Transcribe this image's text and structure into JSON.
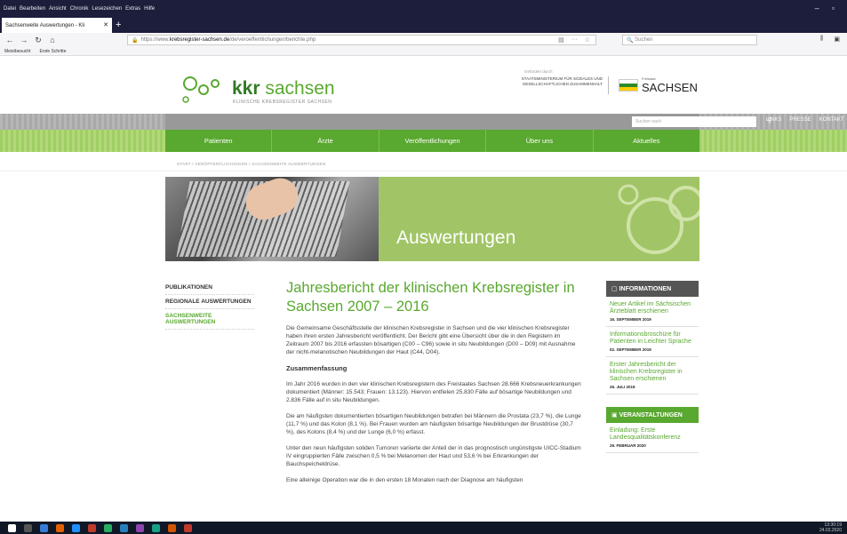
{
  "browser": {
    "menu": [
      "Datei",
      "Bearbeiten",
      "Ansicht",
      "Chronik",
      "Lesezeichen",
      "Extras",
      "Hilfe"
    ],
    "tab_title": "Sachsenweite Auswertungen - Kli",
    "url_prefix": "https://www.",
    "url_host": "krebsregister-sachsen.de",
    "url_path": "/de/veroeffentlichungen/berichte.php",
    "search_placeholder": "Suchen",
    "bookmarks": [
      "Meistbesucht",
      "Erste Schritte"
    ]
  },
  "header": {
    "logo_bold": "kkr",
    "logo_rest": " sachsen",
    "logo_sub": "KLINISCHE KREBSREGISTER SACHSEN",
    "gefoerdert": "Gefördert durch",
    "ministry": "STAATSMINISTERIUM FÜR SOZIALES UND GESELLSCHAFTLICHEN ZUSAMMENHALT",
    "freistaat": "Freistaat",
    "sachsen": "SACHSEN",
    "site_search_placeholder": "Suchen nach",
    "top_links": [
      "LINKS",
      "PRESSE",
      "KONTAKT"
    ]
  },
  "main_nav": [
    "Patienten",
    "Ärzte",
    "Veröffentlichungen",
    "Über uns",
    "Aktuelles"
  ],
  "breadcrumb": "START / VERÖFFENTLICHUNGEN / SACHSENWEITE AUSWERTUNGEN",
  "hero_title": "Auswertungen",
  "left_nav": [
    "PUBLIKATIONEN",
    "REGIONALE AUSWERTUNGEN",
    "SACHSENWEITE AUSWERTUNGEN"
  ],
  "article": {
    "title": "Jahresbericht der klinischen Krebsregister in Sachsen 2007 – 2016",
    "p1": "Die Gemeinsame Geschäftsstelle der klinischen Krebsregister in Sachsen und die vier klinischen Krebsregister haben ihren ersten Jahresbericht veröffentlicht. Der Bericht gibt eine Übersicht über die in den Registern im Zeitraum 2007 bis 2016 erfassten bösartigen (C00 – C96) sowie in situ Neubildungen (D00 – D09) mit Ausnahme der nicht-melanotischen Neubildungen der Haut (C44, D04).",
    "summary_heading": "Zusammenfassung",
    "p2": "Im Jahr 2016 wurden in den vier klinischen Krebsregistern des Freistaates Sachsen 28.666 Krebsneuerkrankungen dokumentiert (Männer: 15.543; Frauen: 13.123). Hiervon entfielen 25.830 Fälle auf bösartige Neubildungen und 2.836 Fälle auf in situ Neubildungen.",
    "p3": "Die am häufigsten dokumentierten bösartigen Neubildungen betrafen bei Männern die Prostata (23,7 %), die Lunge (11,7 %) und das Kolon (8,1 %). Bei Frauen wurden am häufigsten bösartige Neubildungen der Brustdrüse (30,7 %), des Kolons (8,4 %) und der Lunge (6,0 %) erfasst.",
    "p4": "Unter den neun häufigsten soliden Tumoren variierte der Anteil der in das prognostisch ungünstigste UICC-Stadium IV eingruppierten Fälle zwischen 0,5 % bei Melanomen der Haut und 53,6 % bei Erkrankungen der Bauchspeicheldrüse.",
    "p5": "Eine alleinige Operation war die in den ersten 18 Monaten nach der Diagnose am häufigsten"
  },
  "sidebar": {
    "info_heading": "INFORMATIONEN",
    "news": [
      {
        "title": "Neuer Artikel im Sächsischen Ärzteblatt erschienen",
        "date": "16. SEPTEMBER 2019"
      },
      {
        "title": "Informationsbroschüre für Patienten in Leichter Sprache",
        "date": "02. SEPTEMBER 2019"
      },
      {
        "title": "Erster Jahresbericht der klinischen Krebsregister in Sachsen erschienen",
        "date": "26. JULI 2019"
      }
    ],
    "events_heading": "VERANSTALTUNGEN",
    "events": [
      {
        "title": "Einladung: Erste Landesqualitätskonferenz",
        "date": "29. FEBRUAR 2020"
      }
    ]
  },
  "taskbar": {
    "time": "13:30:19",
    "date": "24.02.2020"
  },
  "colors": {
    "accent_green": "#59a82f",
    "dark_green": "#2f7a23"
  }
}
